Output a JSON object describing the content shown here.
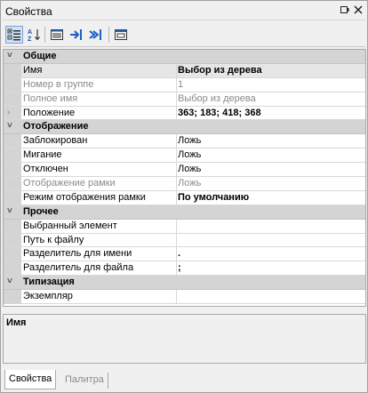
{
  "window": {
    "title": "Свойства",
    "buttons": [
      "pin",
      "close"
    ]
  },
  "toolbar": {
    "tools": [
      "categorized-icon",
      "alphabetical-sort-icon",
      "properties-page-icon",
      "jump-right-icon",
      "jump-right-double-icon",
      "events-icon"
    ]
  },
  "grid": {
    "categories": [
      {
        "name": "Общие",
        "rows": [
          {
            "name": "Имя",
            "value": "Выбор из дерева",
            "bold": true,
            "selected": true,
            "disabled": false,
            "expandable": false
          },
          {
            "name": "Номер в группе",
            "value": "1",
            "bold": false,
            "selected": false,
            "disabled": true,
            "expandable": false
          },
          {
            "name": "Полное имя",
            "value": "Выбор из дерева",
            "bold": false,
            "selected": false,
            "disabled": true,
            "expandable": false
          },
          {
            "name": "Положение",
            "value": "363; 183; 418; 368",
            "bold": true,
            "selected": false,
            "disabled": false,
            "expandable": true
          }
        ]
      },
      {
        "name": "Отображение",
        "rows": [
          {
            "name": "Заблокирован",
            "value": "Ложь",
            "bold": false,
            "selected": false,
            "disabled": false,
            "expandable": false
          },
          {
            "name": "Мигание",
            "value": "Ложь",
            "bold": false,
            "selected": false,
            "disabled": false,
            "expandable": false
          },
          {
            "name": "Отключен",
            "value": "Ложь",
            "bold": false,
            "selected": false,
            "disabled": false,
            "expandable": false
          },
          {
            "name": "Отображение рамки",
            "value": "Ложь",
            "bold": false,
            "selected": false,
            "disabled": true,
            "expandable": false
          },
          {
            "name": "Режим отображения рамки",
            "value": "По умолчанию",
            "bold": true,
            "selected": false,
            "disabled": false,
            "expandable": false
          }
        ]
      },
      {
        "name": "Прочее",
        "rows": [
          {
            "name": "Выбранный элемент",
            "value": "",
            "bold": false,
            "selected": false,
            "disabled": false,
            "expandable": false
          },
          {
            "name": "Путь к файлу",
            "value": "",
            "bold": false,
            "selected": false,
            "disabled": false,
            "expandable": false
          },
          {
            "name": "Разделитель для имени",
            "value": ".",
            "bold": true,
            "selected": false,
            "disabled": false,
            "expandable": false
          },
          {
            "name": "Разделитель для файла",
            "value": ";",
            "bold": true,
            "selected": false,
            "disabled": false,
            "expandable": false
          }
        ]
      },
      {
        "name": "Типизация",
        "rows": [
          {
            "name": "Экземпляр",
            "value": "",
            "bold": false,
            "selected": false,
            "disabled": false,
            "expandable": false
          }
        ]
      }
    ]
  },
  "description": {
    "title": "Имя"
  },
  "tabs": [
    {
      "label": "Свойства",
      "active": true
    },
    {
      "label": "Палитра",
      "active": false
    }
  ]
}
